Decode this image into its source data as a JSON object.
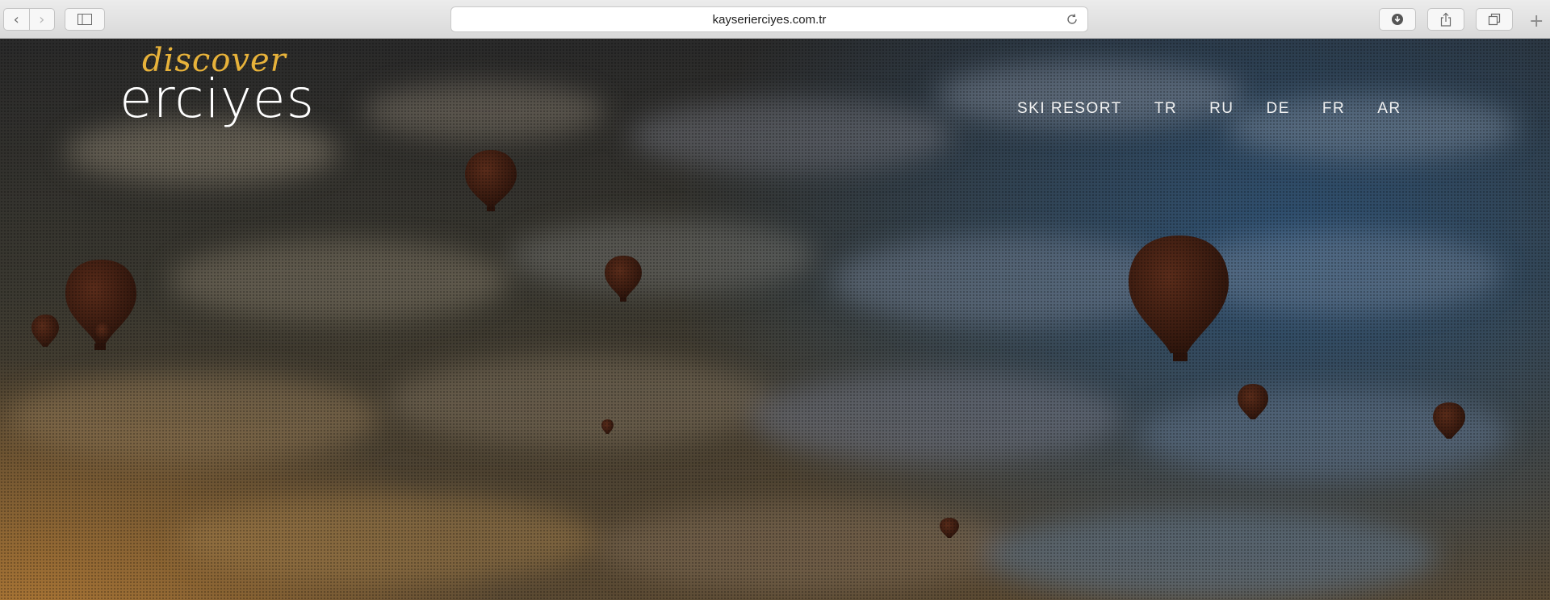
{
  "browser": {
    "url": "kayserierciyes.com.tr",
    "back_icon": "chevron-left-icon",
    "forward_icon": "chevron-right-icon",
    "sidebar_icon": "sidebar-icon",
    "reload_icon": "reload-icon",
    "download_icon": "download-icon",
    "share_icon": "share-icon",
    "tabs_icon": "tabs-icon",
    "new_tab_icon": "plus-icon",
    "new_tab_glyph": "+"
  },
  "site": {
    "logo_script": "discover",
    "logo_main": "erciyes",
    "nav": [
      {
        "label": "SKI RESORT"
      },
      {
        "label": "TR"
      },
      {
        "label": "RU"
      },
      {
        "label": "DE"
      },
      {
        "label": "FR"
      },
      {
        "label": "AR"
      }
    ]
  },
  "colors": {
    "logo_accent": "#e7b23a",
    "nav_text": "#f2f2f2",
    "balloon": "#3a1d12"
  }
}
